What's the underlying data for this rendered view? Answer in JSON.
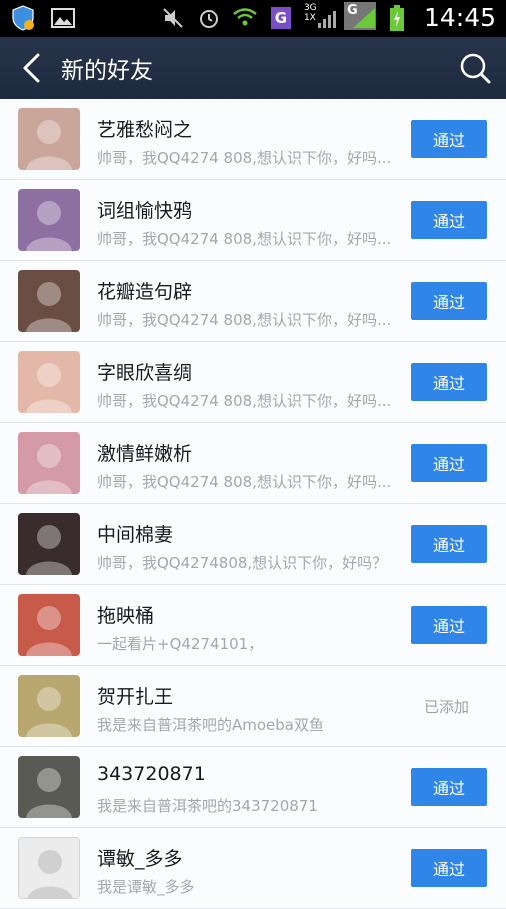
{
  "status_bar": {
    "time": "14:45",
    "network_3g": "3G",
    "network_1x": "1X",
    "g_label": "G",
    "g2_label": "G"
  },
  "header": {
    "title": "新的好友"
  },
  "friends": [
    {
      "name": "艺雅愁闷之",
      "message": "帅哥，我QQ4274 808,想认识下你，好吗...",
      "action": "通过",
      "avatar_color": "#c9a59a"
    },
    {
      "name": "词组愉快鸦",
      "message": "帅哥，我QQ4274 808,想认识下你，好吗...",
      "action": "通过",
      "avatar_color": "#8e6fa1"
    },
    {
      "name": "花瓣造句辟",
      "message": "帅哥，我QQ4274 808,想认识下你，好吗...",
      "action": "通过",
      "avatar_color": "#6b4e43"
    },
    {
      "name": "字眼欣喜绸",
      "message": "帅哥，我QQ4274 808,想认识下你，好吗...",
      "action": "通过",
      "avatar_color": "#e3b8a8"
    },
    {
      "name": "激情鲜嫩析",
      "message": "帅哥，我QQ4274 808,想认识下你，好吗...",
      "action": "通过",
      "avatar_color": "#d59aa8"
    },
    {
      "name": "中间棉妻",
      "message": "帅哥，我QQ4274808,想认识下你，好吗？",
      "action": "通过",
      "avatar_color": "#3a2c2c"
    },
    {
      "name": "拖映桶",
      "message": "一起看片+Q4274101，",
      "action": "通过",
      "avatar_color": "#c85a4a"
    },
    {
      "name": "贺开扎王",
      "message": "我是来自普洱茶吧的Amoeba双鱼",
      "added": "已添加",
      "avatar_color": "#b8a870"
    },
    {
      "name": "343720871",
      "message": "我是来自普洱茶吧的343720871",
      "action": "通过",
      "avatar_color": "#5a5a55"
    },
    {
      "name": "谭敏_多多",
      "message": "我是谭敏_多多",
      "action": "通过",
      "avatar_color": "#e2e2e2"
    }
  ]
}
